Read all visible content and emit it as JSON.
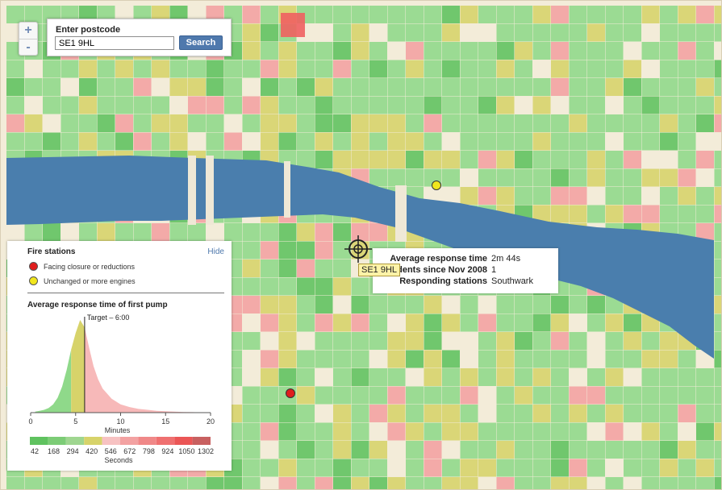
{
  "map": {
    "colors": {
      "water": "#4a7ead",
      "land": "#f3ecd9",
      "bin_green_dark": "#5fc25f",
      "bin_green": "#8fd98a",
      "bin_yellow": "#d7d36a",
      "bin_pink": "#f3a2a2",
      "bin_red": "#ef6060"
    },
    "zoom_in_label": "+",
    "zoom_out_label": "-"
  },
  "search": {
    "label": "Enter postcode",
    "value": "SE1 9HL",
    "button_label": "Search"
  },
  "marker": {
    "postcode_label": "SE1 9HL",
    "crosshair_icon": "crosshair-icon"
  },
  "info": {
    "rows": [
      {
        "key": "Average response time",
        "value": "2m 44s"
      },
      {
        "key": "Incidents since Nov 2008",
        "value": "1"
      },
      {
        "key": "Responding stations",
        "value": "Southwark"
      }
    ]
  },
  "legend": {
    "title": "Fire stations",
    "hide_label": "Hide",
    "items": [
      {
        "label": "Facing closure or reductions",
        "color": "#e01e1e"
      },
      {
        "label": "Unchanged or more engines",
        "color": "#f1e61d"
      }
    ],
    "histogram_title": "Average response time of first pump"
  },
  "chart_data": {
    "type": "area",
    "title": "Average response time of first pump",
    "xlabel": "Minutes",
    "xlim": [
      0,
      20
    ],
    "x_ticks": [
      "0",
      "5",
      "10",
      "15",
      "20"
    ],
    "target_label": "Target – 6:00",
    "target_minutes": 6,
    "x": [
      0.5,
      1,
      1.5,
      2,
      2.5,
      3,
      3.5,
      4,
      4.5,
      5,
      5.5,
      6,
      6.5,
      7,
      7.5,
      8,
      9,
      10,
      11,
      12,
      13,
      14,
      15,
      16,
      17,
      18,
      19,
      20
    ],
    "values": [
      1,
      2,
      3,
      5,
      9,
      16,
      28,
      46,
      68,
      86,
      100,
      92,
      70,
      50,
      36,
      26,
      15,
      9,
      6,
      4,
      3,
      2,
      1.5,
      1,
      0.7,
      0.5,
      0.3,
      0.2
    ],
    "band_colors": {
      "green": "#8fd98a",
      "yellow": "#d7d36a",
      "pink": "#f7b9b9"
    },
    "scale_label": "Seconds",
    "scale_ticks": [
      "42",
      "168",
      "294",
      "420",
      "546",
      "672",
      "798",
      "924",
      "1050",
      "1302"
    ],
    "scale_colors": [
      "#5fc25f",
      "#7ccc76",
      "#9fd690",
      "#d7d36a",
      "#f7c2c2",
      "#f3a2a2",
      "#f08888",
      "#ef7070",
      "#eb5656",
      "#c86060"
    ]
  }
}
